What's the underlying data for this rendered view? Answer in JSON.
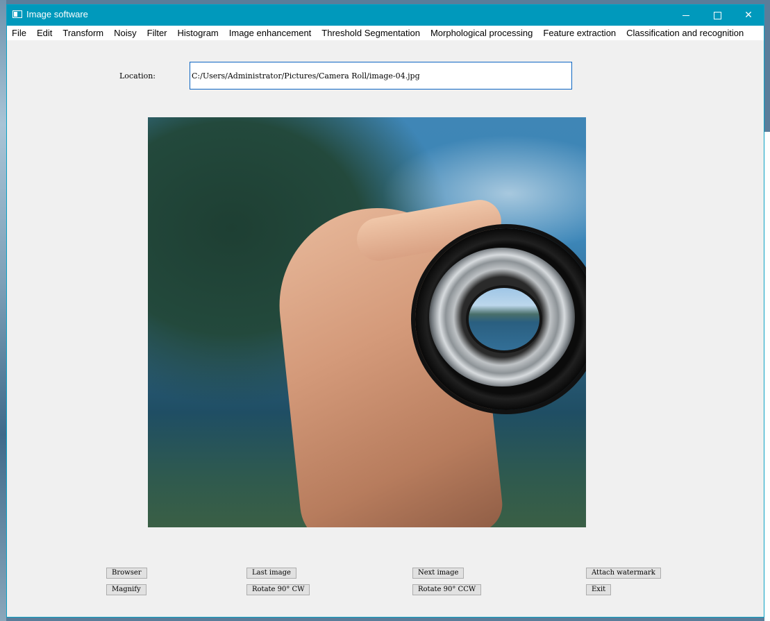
{
  "window": {
    "title": "Image software"
  },
  "menu": [
    "File",
    "Edit",
    "Transform",
    "Noisy",
    "Filter",
    "Histogram",
    "Image enhancement",
    "Threshold Segmentation",
    "Morphological processing",
    "Feature extraction",
    "Classification and recognition"
  ],
  "location": {
    "label": "Location:",
    "value": "C:/Users/Administrator/Pictures/Camera Roll/image-04.jpg"
  },
  "buttons": {
    "browser": "Browser",
    "last_image": "Last image",
    "next_image": "Next image",
    "attach_watermark": "Attach watermark",
    "magnify": "Magnify",
    "rotate_cw": "Rotate 90° CW",
    "rotate_ccw": "Rotate 90°  CCW",
    "exit": "Exit"
  },
  "colors": {
    "titlebar": "#0099bc",
    "input_border": "#0a64c2"
  }
}
